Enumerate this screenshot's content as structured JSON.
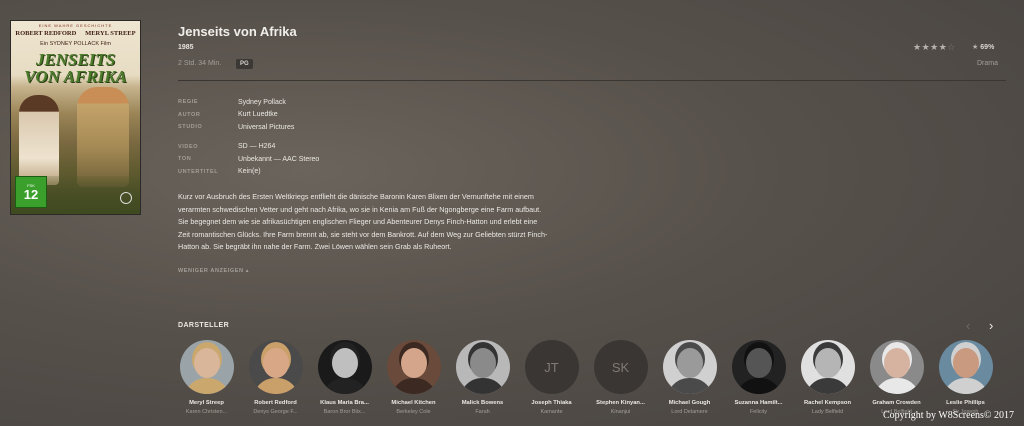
{
  "poster": {
    "tagline": "EINE WAHRE GESCHICHTE",
    "actor1": "ROBERT REDFORD",
    "actor2": "MERYL STREEP",
    "director_line": "Ein SYDNEY POLLACK Film",
    "title_line1": "JENSEITS",
    "title_line2": "VON AFRIKA",
    "fsk_label": "FSK",
    "fsk_value": "12"
  },
  "movie": {
    "title": "Jenseits von Afrika",
    "year": "1985",
    "runtime": "2 Std. 34 Min.",
    "content_rating": "PG",
    "stars_filled": "★★★★",
    "stars_empty": "☆",
    "score": "69%",
    "genre": "Drama"
  },
  "details": [
    {
      "label": "REGIE",
      "value": "Sydney Pollack"
    },
    {
      "label": "AUTOR",
      "value": "Kurt Luedtke"
    },
    {
      "label": "STUDIO",
      "value": "Universal Pictures"
    },
    {
      "label": "VIDEO",
      "value": "SD — H264"
    },
    {
      "label": "TON",
      "value": "Unbekannt — AAC Stereo"
    },
    {
      "label": "UNTERTITEL",
      "value": "Kein(e)"
    }
  ],
  "summary": "Kurz vor Ausbruch des Ersten Weltkriegs entflieht die dänische Baronin Karen Blixen der Vernunftehe mit einem verarmten schwedischen Vetter und geht nach Afrika, wo sie in Kenia am Fuß der Ngongberge eine Farm aufbaut. Sie begegnet dem wie sie afrikasüchtigen englischen Flieger und Abenteurer Denys Finch-Hatton und erlebt eine Zeit romantischen Glücks. Ihre Farm brennt ab, sie steht vor dem Bankrott. Auf dem Weg zur Geliebten stürzt Finch-Hatton ab. Sie begräbt ihn nahe der Farm. Zwei Löwen wählen sein Grab als Ruheort.",
  "less_label": "WENIGER ANZEIGEN ▴",
  "cast_header": "DARSTELLER",
  "nav": {
    "prev": "‹",
    "next": "›"
  },
  "cast": [
    {
      "name": "Meryl Streep",
      "role": "Karen Christen...",
      "initials": "",
      "skin": "#d9b59a",
      "hair": "#c9a76d",
      "bg": "#9aa4a8"
    },
    {
      "name": "Robert Redford",
      "role": "Denys George F...",
      "initials": "",
      "skin": "#d8a786",
      "hair": "#caa06a",
      "bg": "#4a4a4a"
    },
    {
      "name": "Klaus Maria Bra...",
      "role": "Baron Bror Blix...",
      "initials": "",
      "skin": "#bfbfbf",
      "hair": "#222222",
      "bg": "#1a1a1a"
    },
    {
      "name": "Michael Kitchen",
      "role": "Berkeley Cole",
      "initials": "",
      "skin": "#d4a58b",
      "hair": "#3c2a22",
      "bg": "#6a4a3a"
    },
    {
      "name": "Malick Bowens",
      "role": "Farah",
      "initials": "",
      "skin": "#8a8a8a",
      "hair": "#333333",
      "bg": "#b8b8b8"
    },
    {
      "name": "Joseph Thiaka",
      "role": "Kamante",
      "initials": "JT",
      "skin": "",
      "hair": "",
      "bg": "#3a3633"
    },
    {
      "name": "Stephen Kinyan...",
      "role": "Kinanjui",
      "initials": "SK",
      "skin": "",
      "hair": "",
      "bg": "#3a3633"
    },
    {
      "name": "Michael Gough",
      "role": "Lord Delamere",
      "initials": "",
      "skin": "#9a9a9a",
      "hair": "#4a4a4a",
      "bg": "#d0d0d0"
    },
    {
      "name": "Suzanna Hamilt...",
      "role": "Felicity",
      "initials": "",
      "skin": "#555555",
      "hair": "#111111",
      "bg": "#222222"
    },
    {
      "name": "Rachel Kempson",
      "role": "Lady Belfield",
      "initials": "",
      "skin": "#b5b5b5",
      "hair": "#3a3a3a",
      "bg": "#e0e0e0"
    },
    {
      "name": "Graham Crowden",
      "role": "Lord Belfield",
      "initials": "",
      "skin": "#d6b3a0",
      "hair": "#e8e8e8",
      "bg": "#8a8a8a"
    },
    {
      "name": "Leslie Phillips",
      "role": "Sir Joseph",
      "initials": "",
      "skin": "#c99a80",
      "hair": "#d0d0d0",
      "bg": "#6a8aa0"
    }
  ],
  "copyright": "Copyright by W8Screens© 2017"
}
